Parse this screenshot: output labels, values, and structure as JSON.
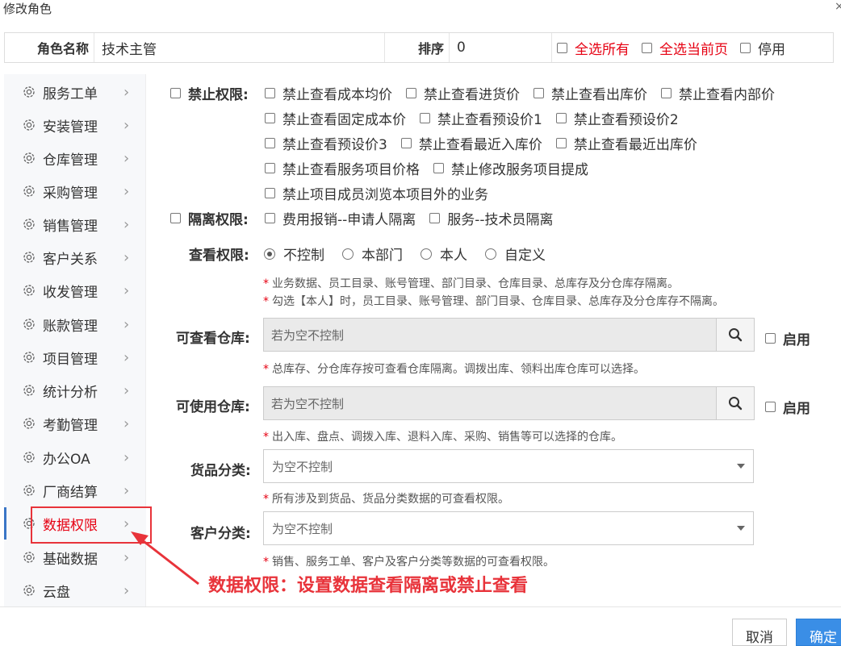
{
  "window": {
    "title": "修改角色",
    "close": "×"
  },
  "header": {
    "role_name_label": "角色名称",
    "role_name_value": "技术主管",
    "sort_label": "排序",
    "sort_value": "0",
    "select_all": "全选所有",
    "select_page": "全选当前页",
    "disable": "停用"
  },
  "sidebar": {
    "items": [
      {
        "label": "服务工单"
      },
      {
        "label": "安装管理"
      },
      {
        "label": "仓库管理"
      },
      {
        "label": "采购管理"
      },
      {
        "label": "销售管理"
      },
      {
        "label": "客户关系"
      },
      {
        "label": "收发管理"
      },
      {
        "label": "账款管理"
      },
      {
        "label": "项目管理"
      },
      {
        "label": "统计分析"
      },
      {
        "label": "考勤管理"
      },
      {
        "label": "办公OA"
      },
      {
        "label": "厂商结算"
      },
      {
        "label": "数据权限"
      },
      {
        "label": "基础数据"
      },
      {
        "label": "云盘"
      }
    ],
    "active_index": 13
  },
  "prohibit": {
    "label": "禁止权限:",
    "options": [
      "禁止查看成本均价",
      "禁止查看进货价",
      "禁止查看出库价",
      "禁止查看内部价",
      "禁止查看固定成本价",
      "禁止查看预设价1",
      "禁止查看预设价2",
      "禁止查看预设价3",
      "禁止查看最近入库价",
      "禁止查看最近出库价",
      "禁止查看服务项目价格",
      "禁止修改服务项目提成",
      "禁止项目成员浏览本项目外的业务"
    ]
  },
  "isolate": {
    "label": "隔离权限:",
    "options": [
      "费用报销--申请人隔离",
      "服务--技术员隔离"
    ]
  },
  "view": {
    "label": "查看权限:",
    "options": [
      "不控制",
      "本部门",
      "本人",
      "自定义"
    ],
    "selected": 0,
    "notes": [
      "业务数据、员工目录、账号管理、部门目录、仓库目录、总库存及分仓库存隔离。",
      "勾选【本人】时，员工目录、账号管理、部门目录、仓库目录、总库存及分仓库存不隔离。"
    ]
  },
  "view_warehouse": {
    "label": "可查看仓库:",
    "placeholder": "若为空不控制",
    "enable": "启用",
    "note": "总库存、分仓库存按可查看仓库隔离。调拨出库、领料出库仓库可以选择。"
  },
  "use_warehouse": {
    "label": "可使用仓库:",
    "placeholder": "若为空不控制",
    "enable": "启用",
    "note": "出入库、盘点、调拨入库、退料入库、采购、销售等可以选择的仓库。"
  },
  "goods_category": {
    "label": "货品分类:",
    "placeholder": "为空不控制",
    "note": "所有涉及到货品、货品分类数据的可查看权限。"
  },
  "customer_category": {
    "label": "客户分类:",
    "placeholder": "为空不控制",
    "note": "销售、服务工单、客户及客户分类等数据的可查看权限。"
  },
  "annotation": "数据权限：设置数据查看隔离或禁止查看",
  "footer": {
    "cancel": "取消",
    "ok": "确定"
  },
  "colors": {
    "accent_red": "#e60012",
    "active_border": "#3a76c6",
    "primary_button": "#3a8ee6"
  }
}
